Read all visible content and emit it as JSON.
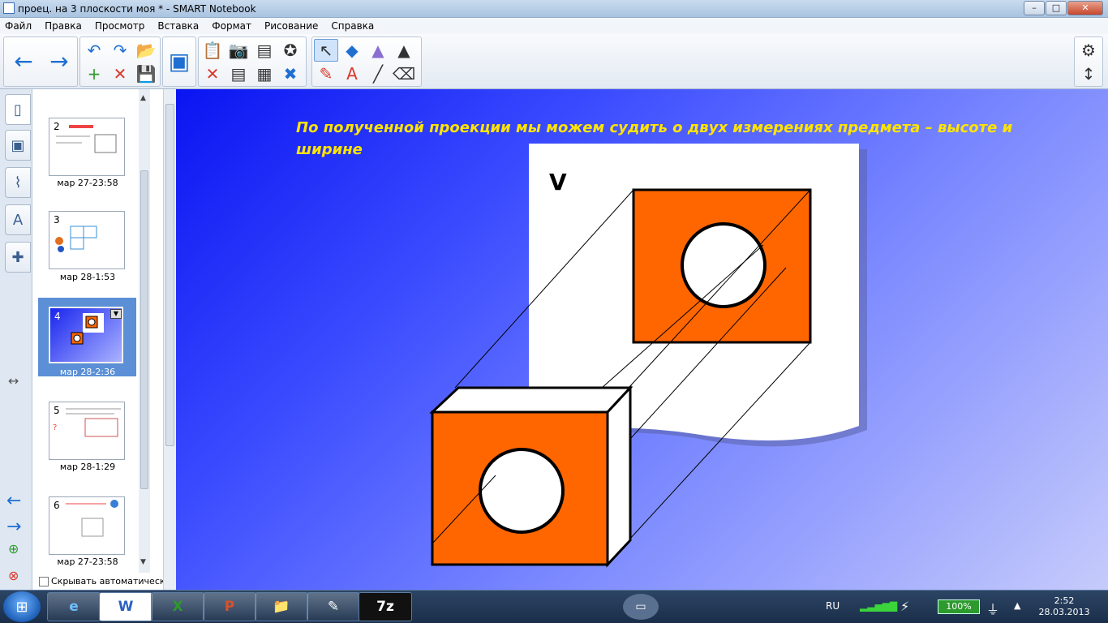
{
  "window": {
    "title": "проец. на 3 плоскости моя * - SMART Notebook",
    "btn_min": "–",
    "btn_max": "□",
    "btn_close": "✕"
  },
  "menu": {
    "items": [
      "Файл",
      "Правка",
      "Просмотр",
      "Вставка",
      "Формат",
      "Рисование",
      "Справка"
    ]
  },
  "toolbar": {
    "icons": {
      "back": "←",
      "forward": "→",
      "undo": "↶",
      "redo": "↷",
      "open": "📂",
      "save": "💾",
      "add_page": "+",
      "delete_page": "✕",
      "screen": "▣",
      "paste": "📋",
      "camera": "📷",
      "screen_shade": "▤",
      "table": "▦",
      "clear": "✖",
      "select": "↖",
      "pen": "✎",
      "text": "A",
      "line": "╱",
      "eraser": "⌫",
      "shapes": "◆",
      "fill": "▲",
      "settings": "⚙",
      "move_toolbar": "↕",
      "delete": "✕",
      "recognize": "✎",
      "magic": "✪"
    }
  },
  "sorter": {
    "pages": [
      {
        "num": "2",
        "date": "мар 27-23:58"
      },
      {
        "num": "3",
        "date": "мар 28-1:53"
      },
      {
        "num": "4",
        "date": "мар 28-2:36"
      },
      {
        "num": "5",
        "date": "мар 28-1:29"
      },
      {
        "num": "6",
        "date": "мар 27-23:58"
      }
    ],
    "hide_auto": "Скрывать автоматическ"
  },
  "slide": {
    "text": "По полученной проекции мы можем судить о двух измерениях предмета – высоте и ширине",
    "plane_label": "V"
  },
  "taskbar": {
    "lang": "RU",
    "battery": "100%",
    "time": "2:52",
    "date": "28.03.2013",
    "apps": [
      "e",
      "W",
      "X",
      "P",
      "📁",
      "✎",
      "7z"
    ]
  }
}
